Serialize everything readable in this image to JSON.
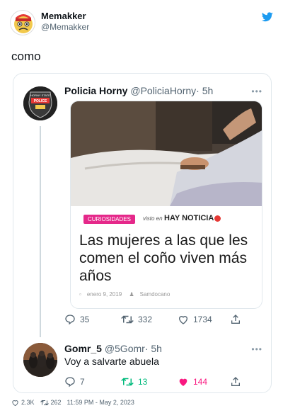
{
  "author": {
    "name": "Memakker",
    "handle": "@Memakker"
  },
  "tweet": {
    "text": "como"
  },
  "quoted": {
    "name": "Policia Horny",
    "handle": "@PoliciaHorny",
    "time": "· 5h",
    "avatar_text": [
      "HORNY STATE",
      "POLICE"
    ],
    "news": {
      "badge": "CURIOSIDADES",
      "visto": "visto en",
      "brand": "HAY NOTICIA",
      "headline": "Las mujeres a las que les comen el coño viven más años",
      "date": "enero 9, 2019",
      "author": "Samdocano"
    },
    "replies": "35",
    "retweets": "332",
    "likes": "1734"
  },
  "reply": {
    "name": "Gomr_5",
    "handle": "@5Gomr",
    "time": "· 5h",
    "text": "Voy a salvarte abuela",
    "replies": "7",
    "retweets": "13",
    "likes": "144"
  },
  "footer": {
    "likes": "2.3K",
    "retweets": "262",
    "timestamp": "11:59 PM - May 2, 2023"
  },
  "colors": {
    "accent": "#1d9bf0",
    "retweet": "#00ba7c",
    "like": "#f91880",
    "badge": "#e5288a"
  }
}
